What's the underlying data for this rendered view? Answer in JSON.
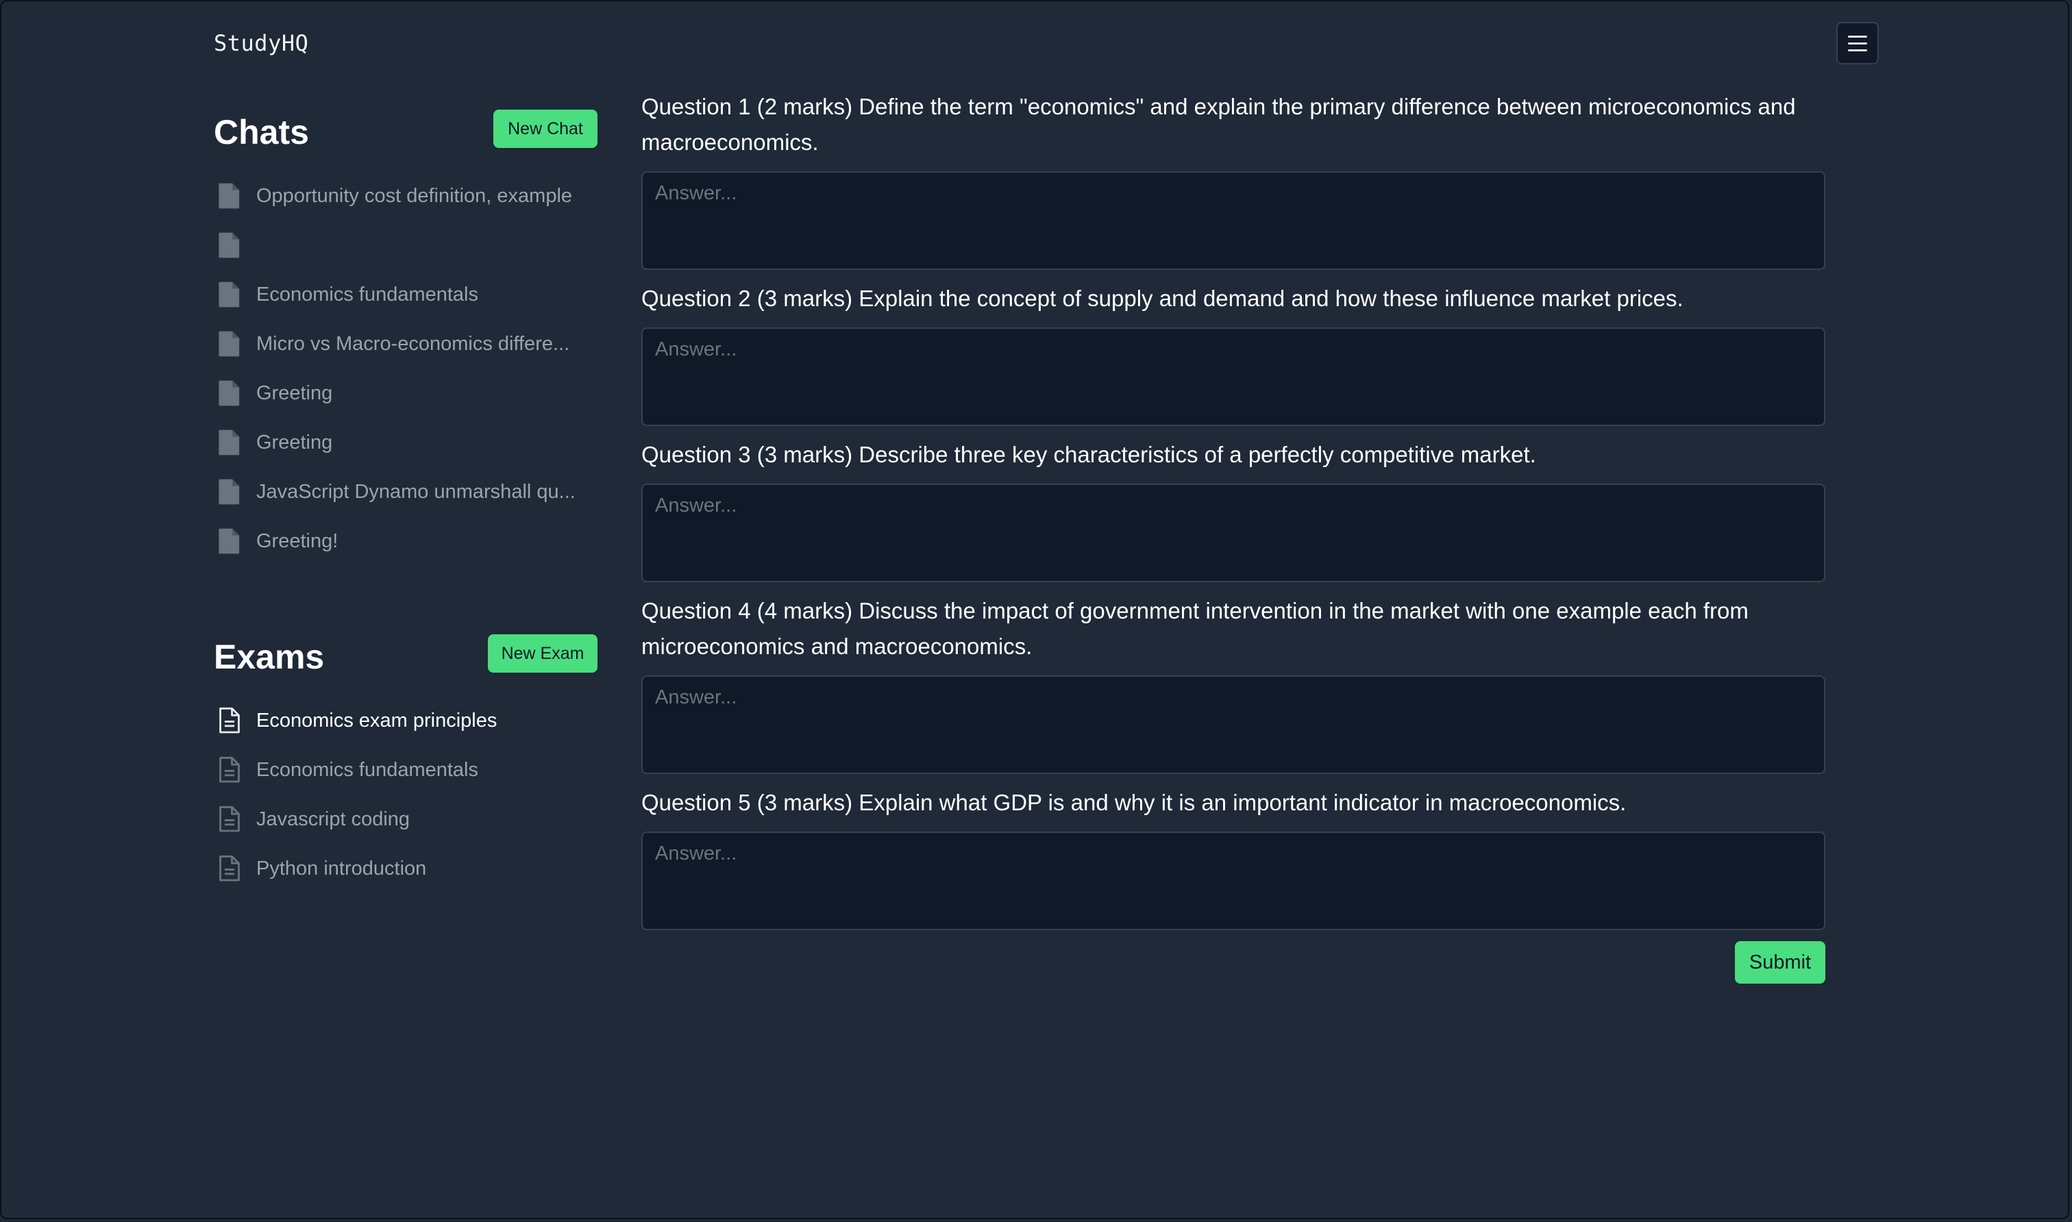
{
  "app": {
    "title": "StudyHQ"
  },
  "header": {
    "menu_icon": "hamburger-menu-icon"
  },
  "chats": {
    "title": "Chats",
    "new_label": "New Chat",
    "item_icon": "file-solid-icon",
    "items": [
      {
        "label": "Opportunity cost definition, example"
      },
      {
        "label": ""
      },
      {
        "label": "Economics fundamentals"
      },
      {
        "label": "Micro vs Macro-economics differe..."
      },
      {
        "label": "Greeting"
      },
      {
        "label": "Greeting"
      },
      {
        "label": "JavaScript Dynamo unmarshall qu..."
      },
      {
        "label": "Greeting!"
      }
    ]
  },
  "exams": {
    "title": "Exams",
    "new_label": "New Exam",
    "item_icon": "file-text-outline-icon",
    "items": [
      {
        "label": "Economics exam principles",
        "active": true
      },
      {
        "label": "Economics fundamentals"
      },
      {
        "label": "Javascript coding"
      },
      {
        "label": "Python introduction"
      }
    ]
  },
  "exam": {
    "questions": [
      {
        "text": "Question 1 (2 marks) Define the term \"economics\" and explain the primary difference between microeconomics and macroeconomics.",
        "placeholder": "Answer..."
      },
      {
        "text": "Question 2 (3 marks) Explain the concept of supply and demand and how these influence market prices.",
        "placeholder": "Answer..."
      },
      {
        "text": "Question 3 (3 marks) Describe three key characteristics of a perfectly competitive market.",
        "placeholder": "Answer..."
      },
      {
        "text": "Question 4 (4 marks) Discuss the impact of government intervention in the market with one example each from microeconomics and macroeconomics.",
        "placeholder": "Answer..."
      },
      {
        "text": "Question 5 (3 marks) Explain what GDP is and why it is an important indicator in macroeconomics.",
        "placeholder": "Answer..."
      }
    ],
    "submit_label": "Submit"
  },
  "colors": {
    "background": "#1f2937",
    "input_background": "#111827",
    "accent": "#4ade80",
    "muted_text": "#9ca3af"
  }
}
